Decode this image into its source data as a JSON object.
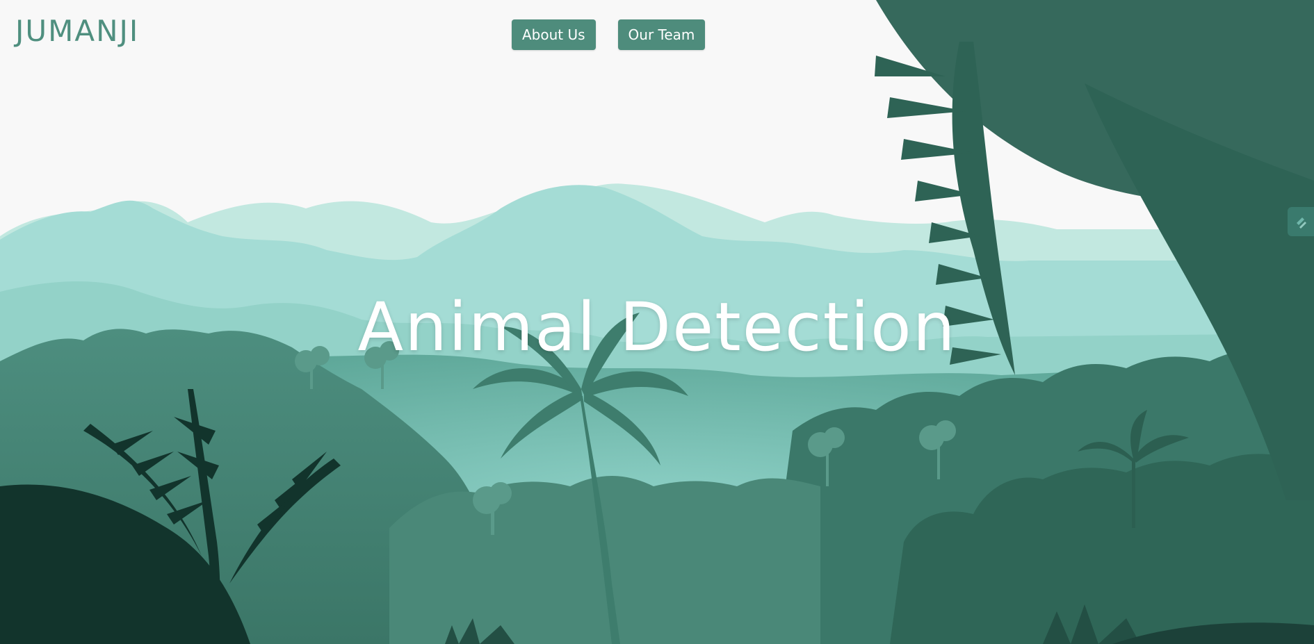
{
  "header": {
    "logo_text": "JUMANJI"
  },
  "nav": {
    "items": [
      {
        "label": "About Us"
      },
      {
        "label": "Our Team"
      }
    ]
  },
  "hero": {
    "title": "Animal Detection"
  },
  "colors": {
    "background": "#f8f8f8",
    "accent": "#4e8c7c",
    "logo": "#4f8f7f",
    "mountain_far": "#c2e8e0",
    "mountain_mid": "#a4dcd5",
    "forest_dark": "#2f6657",
    "foliage_darkest": "#12342c"
  },
  "icons": {
    "background_art": "jungle-landscape-illustration",
    "side_widget": "extension-widget-icon"
  }
}
